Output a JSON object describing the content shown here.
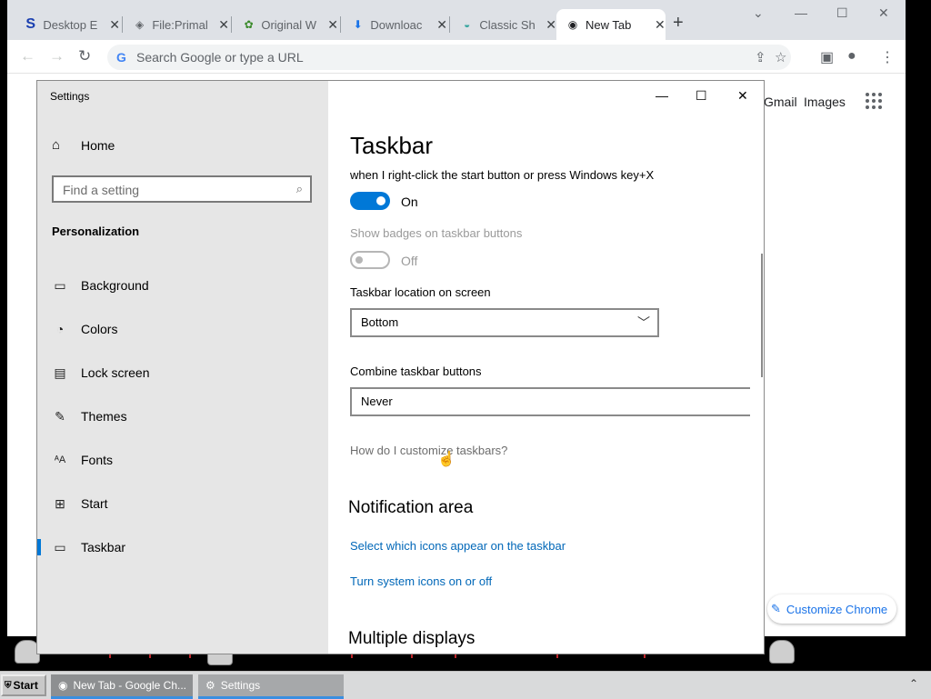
{
  "browser": {
    "tabs": [
      {
        "label": "Desktop E",
        "icon": "s-logo-icon"
      },
      {
        "label": "File:Primal",
        "icon": "globe-icon"
      },
      {
        "label": "Original W",
        "icon": "swirl-icon"
      },
      {
        "label": "Downloac",
        "icon": "download-icon"
      },
      {
        "label": "Classic Sh",
        "icon": "shell-icon"
      },
      {
        "label": "New Tab",
        "icon": "chrome-icon"
      }
    ],
    "omnibox_placeholder": "Search Google or type a URL",
    "gmail": "Gmail",
    "images": "Images",
    "customize_chrome": "Customize Chrome"
  },
  "settings": {
    "window_title": "Settings",
    "nav_home": "Home",
    "search_placeholder": "Find a setting",
    "section": "Personalization",
    "nav_items": [
      {
        "label": "Background",
        "icon": "image-icon"
      },
      {
        "label": "Colors",
        "icon": "palette-icon"
      },
      {
        "label": "Lock screen",
        "icon": "lock-screen-icon"
      },
      {
        "label": "Themes",
        "icon": "brush-icon"
      },
      {
        "label": "Fonts",
        "icon": "font-icon"
      },
      {
        "label": "Start",
        "icon": "start-icon"
      },
      {
        "label": "Taskbar",
        "icon": "taskbar-icon",
        "active": true
      }
    ],
    "content": {
      "title": "Taskbar",
      "description": "when I right-click the start button or press Windows key+X",
      "toggle1_state": "On",
      "badges_label": "Show badges on taskbar buttons",
      "toggle2_state": "Off",
      "location_label": "Taskbar location on screen",
      "location_value": "Bottom",
      "combine_label": "Combine taskbar buttons",
      "combine_value": "Never",
      "help_link": "How do I customize taskbars?",
      "notification_title": "Notification area",
      "notification_link1": "Select which icons appear on the taskbar",
      "notification_link2": "Turn system icons on or off",
      "multiple_displays_title": "Multiple displays"
    }
  },
  "taskbar": {
    "start_label": "Start",
    "items": [
      {
        "label": "New Tab - Google Ch...",
        "icon": "chrome-icon"
      },
      {
        "label": "Settings",
        "icon": "gear-icon"
      }
    ]
  },
  "colors": {
    "accent": "#0078d7",
    "link": "#0067b8",
    "chrome_link": "#1a73e8"
  }
}
